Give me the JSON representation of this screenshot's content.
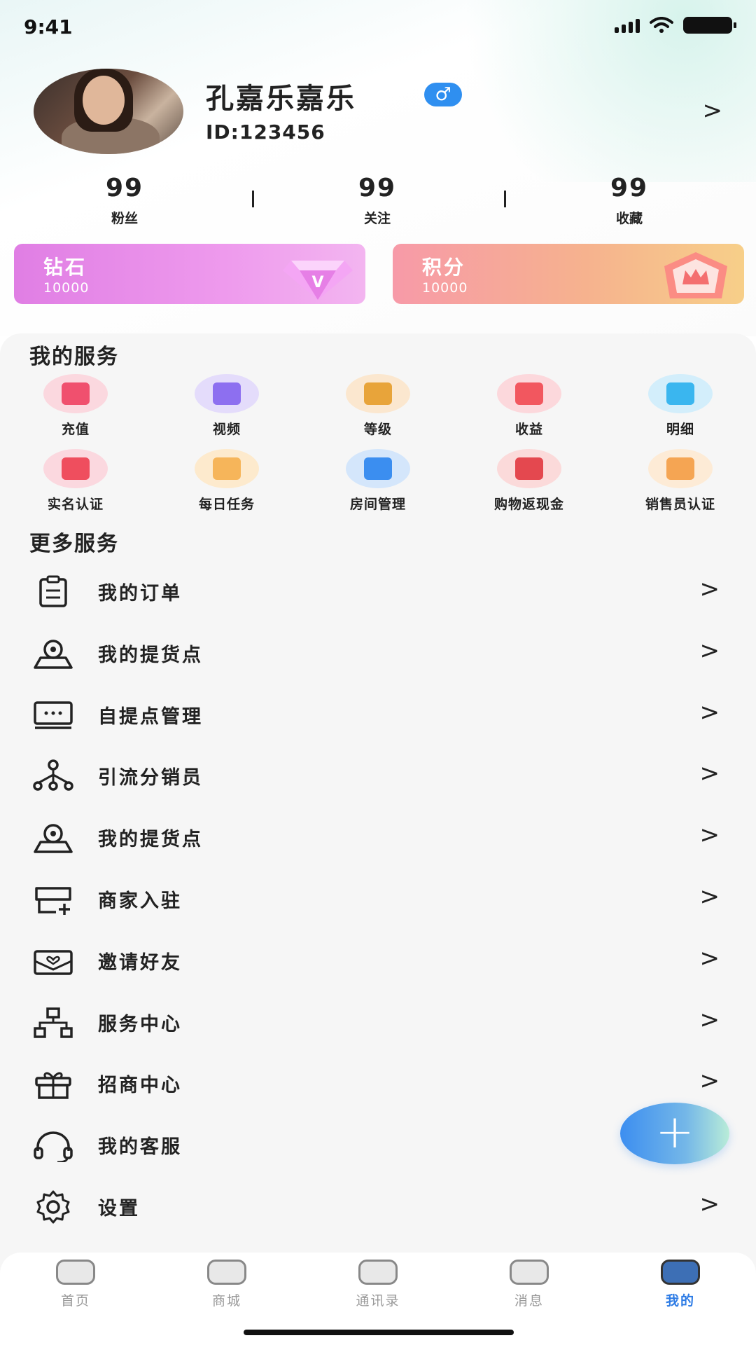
{
  "status_bar": {
    "time": "9:41"
  },
  "profile": {
    "name": "孔嘉乐嘉乐",
    "gender_symbol": "♂",
    "id": "ID:123456",
    "arrow": ">"
  },
  "stats": [
    {
      "value": "99",
      "label": "粉丝"
    },
    {
      "value": "99",
      "label": "关注"
    },
    {
      "value": "99",
      "label": "收藏"
    }
  ],
  "assets": {
    "diamond": {
      "title": "钻石",
      "value": "10000"
    },
    "points": {
      "title": "积分",
      "value": "10000"
    }
  },
  "my_services": {
    "title": "我的服务",
    "items": [
      {
        "label": "充值",
        "icon": "card-icon",
        "bg": "#fbd8df",
        "fg": "#f0506e"
      },
      {
        "label": "视频",
        "icon": "image-icon",
        "bg": "#e4dcfb",
        "fg": "#8d6ff0"
      },
      {
        "label": "等级",
        "icon": "crown-icon",
        "bg": "#fbe7cf",
        "fg": "#e8a43a"
      },
      {
        "label": "收益",
        "icon": "wallet-icon",
        "bg": "#fcd8dc",
        "fg": "#f2575f"
      },
      {
        "label": "明细",
        "icon": "list-icon",
        "bg": "#d3eefb",
        "fg": "#3ab6ef"
      },
      {
        "label": "实名认证",
        "icon": "medal-icon",
        "bg": "#fbd8df",
        "fg": "#ef4e5e"
      },
      {
        "label": "每日任务",
        "icon": "box-icon",
        "bg": "#fdeacd",
        "fg": "#f6b55a"
      },
      {
        "label": "房间管理",
        "icon": "chart-icon",
        "bg": "#d4e6fb",
        "fg": "#3b8ef0"
      },
      {
        "label": "购物返现金",
        "icon": "cash-icon",
        "bg": "#fbdada",
        "fg": "#e4484f"
      },
      {
        "label": "销售员认证",
        "icon": "person-icon",
        "bg": "#fdebd6",
        "fg": "#f5a553"
      }
    ]
  },
  "more_services": {
    "title": "更多服务",
    "arrow": ">",
    "items": [
      {
        "label": "我的订单",
        "icon": "clipboard-icon"
      },
      {
        "label": "我的提货点",
        "icon": "location-icon"
      },
      {
        "label": "自提点管理",
        "icon": "monitor-icon"
      },
      {
        "label": "引流分销员",
        "icon": "network-icon"
      },
      {
        "label": "我的提货点",
        "icon": "location-icon"
      },
      {
        "label": "商家入驻",
        "icon": "store-add-icon"
      },
      {
        "label": "邀请好友",
        "icon": "envelope-heart-icon"
      },
      {
        "label": "服务中心",
        "icon": "hierarchy-icon"
      },
      {
        "label": "招商中心",
        "icon": "gift-icon"
      },
      {
        "label": "我的客服",
        "icon": "headset-icon"
      },
      {
        "label": "设置",
        "icon": "gear-icon"
      }
    ]
  },
  "fab": {
    "symbol": "+"
  },
  "tabbar": [
    {
      "label": "首页",
      "icon": "home-icon"
    },
    {
      "label": "商城",
      "icon": "shop-icon"
    },
    {
      "label": "通讯录",
      "icon": "contacts-icon"
    },
    {
      "label": "消息",
      "icon": "message-icon"
    },
    {
      "label": "我的",
      "icon": "profile-icon",
      "active": true
    }
  ],
  "colors": {
    "accent": "#2c7be5",
    "panel": "#f6f6f6"
  }
}
